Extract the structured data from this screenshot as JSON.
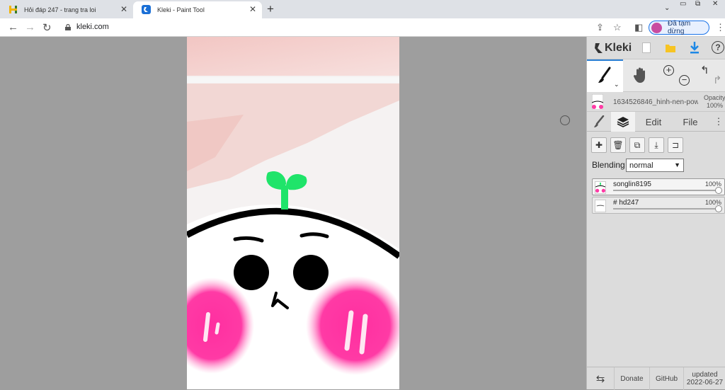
{
  "browser": {
    "tabs": [
      {
        "title": "Hỏi đáp 247 - trang tra loi",
        "active": false
      },
      {
        "title": "Kleki - Paint Tool",
        "active": true
      }
    ],
    "url": "kleki.com",
    "profile_status": "Đã tạm dừng"
  },
  "app": {
    "logo": "Kleki",
    "document_name": "1634526846_hinh-nen-pow",
    "opacity_label": "Opacity",
    "opacity_value": "100%",
    "tabs": [
      "Edit",
      "File"
    ],
    "blending_label": "Blending",
    "blending_value": "normal",
    "layers": [
      {
        "name": "songlin8195",
        "opacity": "100%",
        "selected": true
      },
      {
        "name": "# hd247",
        "opacity": "100%",
        "selected": false
      }
    ],
    "footer": {
      "donate": "Donate",
      "github": "GitHub",
      "updated_label": "updated",
      "updated_date": "2022-06-27"
    }
  },
  "icons": [
    "kleki-favicon",
    "hoidap-favicon",
    "brush-icon",
    "hand-icon",
    "zoom-in-icon",
    "zoom-out-icon",
    "undo-icon",
    "redo-icon",
    "layers-icon",
    "add-layer-icon",
    "delete-layer-icon",
    "duplicate-layer-icon",
    "merge-layer-icon",
    "layer-properties-icon",
    "swap-icon",
    "help-icon",
    "download-icon",
    "save-icon",
    "new-file-icon"
  ],
  "colors": {
    "accent": "#2a7fd4",
    "sprout": "#1fe46a",
    "blush": "#ff2fa0"
  }
}
